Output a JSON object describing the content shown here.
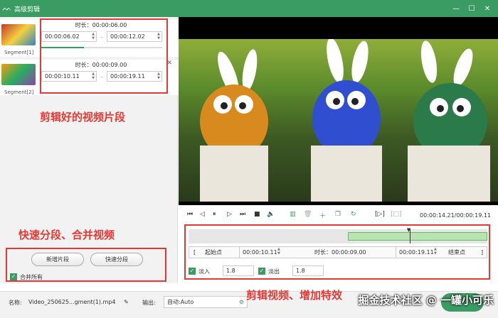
{
  "window": {
    "title": "高级剪辑",
    "min": "—",
    "max": "☐",
    "close": "✕"
  },
  "segments": [
    {
      "name": "Segment[1]",
      "duration": "时长：00:00:06.00",
      "start": "00:00:06.02",
      "end": "00:00:12.02",
      "sep": "-",
      "progress": 0.35
    },
    {
      "name": "Segment[2]",
      "duration": "时长：00:00:09.00",
      "start": "00:00:10.11",
      "end": "00:00:19.11",
      "sep": "-",
      "progress": 0.0
    }
  ],
  "annotations": {
    "clips": "剪辑好的视频片段",
    "split": "快速分段、合并视频",
    "effects": "剪辑视频、增加特效"
  },
  "split_panel": {
    "new_segment": "新增片段",
    "quick_split": "快速分段",
    "merge_all": "合并所有"
  },
  "player": {
    "time": "00:00:14.21/00:00:19.11",
    "playhead_fraction": 0.74
  },
  "edit": {
    "start_label": "起始点",
    "start_time": "00:00:10.11",
    "duration_label": "时长：00:00:09.00",
    "end_time": "00:00:19.11",
    "end_label": "结束点",
    "fade_in_label": "淡入",
    "fade_in_value": "1.8",
    "fade_out_label": "淡出",
    "fade_out_value": "1.8"
  },
  "footer": {
    "name_label": "名称:",
    "filename": "Video_250625...gment(1).mp4",
    "output_label": "输出:",
    "output_value": "自动:Auto"
  },
  "watermark": "掘金技术社区 @ 一罐小可乐",
  "colors": {
    "accent": "#3a9b63",
    "annotation": "#e53935"
  }
}
